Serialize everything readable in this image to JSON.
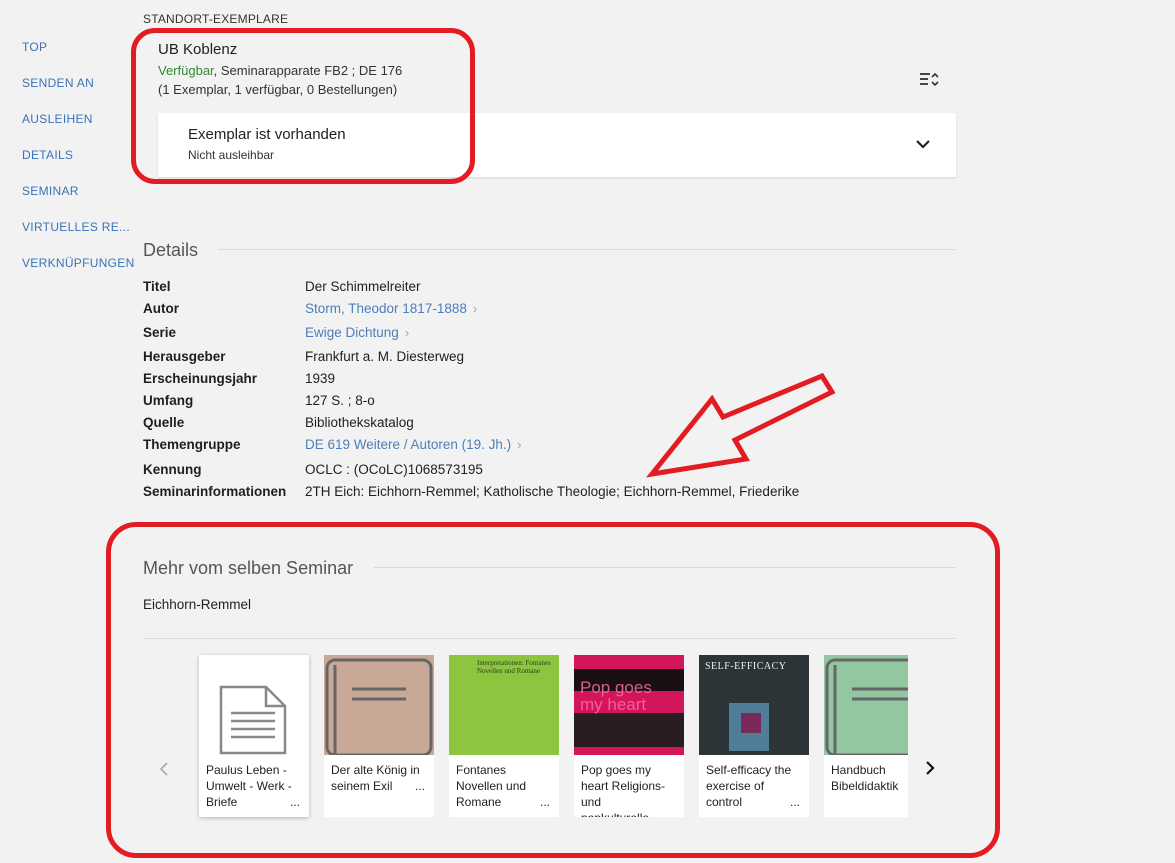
{
  "nav": {
    "items": [
      "TOP",
      "SENDEN AN",
      "AUSLEIHEN",
      "DETAILS",
      "SEMINAR",
      "VIRTUELLES RE...",
      "VERKNÜPFUNGEN"
    ]
  },
  "holdings": {
    "section_label": "STANDORT-EXEMPLARE",
    "library": "UB Koblenz",
    "status": "Verfügbar",
    "location": ", Seminarapparate FB2 ; DE 176",
    "summary": "(1 Exemplar, 1 verfügbar, 0 Bestellungen)",
    "exemplar_title": "Exemplar ist vorhanden",
    "exemplar_sub": "Nicht ausleihbar",
    "status_color": "#2e8b2e"
  },
  "details": {
    "heading": "Details",
    "rows": [
      {
        "label": "Titel",
        "value": "Der Schimmelreiter",
        "link": false
      },
      {
        "label": "Autor",
        "value": "Storm, Theodor 1817-1888",
        "link": true
      },
      {
        "label": "Serie",
        "value": "Ewige Dichtung",
        "link": true
      },
      {
        "label": "Herausgeber",
        "value": "Frankfurt a. M. Diesterweg",
        "link": false
      },
      {
        "label": "Erscheinungsjahr",
        "value": "1939",
        "link": false
      },
      {
        "label": "Umfang",
        "value": "127 S. ; 8-o",
        "link": false
      },
      {
        "label": "Quelle",
        "value": "Bibliothekskatalog",
        "link": false
      },
      {
        "label": "Themengruppe",
        "value": "DE 619 Weitere / Autoren (19. Jh.)",
        "link": true
      },
      {
        "label": "Kennung",
        "value": "OCLC : (OCoLC)1068573195",
        "link": false
      },
      {
        "label": "Seminarinformationen",
        "value": "2TH Eich: Eichhorn-Remmel; Katholische Theologie; Eichhorn-Remmel, Friederike",
        "link": false
      }
    ]
  },
  "seminar": {
    "heading": "Mehr vom selben Seminar",
    "name": "Eichhorn-Remmel",
    "books": [
      {
        "title": "Paulus Leben - Umwelt - Werk - Briefe",
        "cover": "document-icon"
      },
      {
        "title": "Der alte König in seinem Exil",
        "cover": "book-icon"
      },
      {
        "title": "Fontanes Novellen und Romane",
        "cover": "cover-fontane",
        "cover_text": "Interpretationen: Fontanes Novellen und Romane"
      },
      {
        "title": "Pop goes my heart Religions- und popkulturelle Gespräche im",
        "cover": "cover-pop",
        "cover_text": "Pop goes my heart"
      },
      {
        "title": "Self-efficacy the exercise of control",
        "cover": "cover-self-efficacy",
        "cover_text": "SELF-EFFICACY"
      },
      {
        "title": "Handbuch Bibeldidaktik",
        "cover": "book-icon"
      }
    ]
  },
  "ellipsis": "...",
  "colors": {
    "accent_link": "#4d7fb8",
    "annotation_red": "#e21c22"
  }
}
